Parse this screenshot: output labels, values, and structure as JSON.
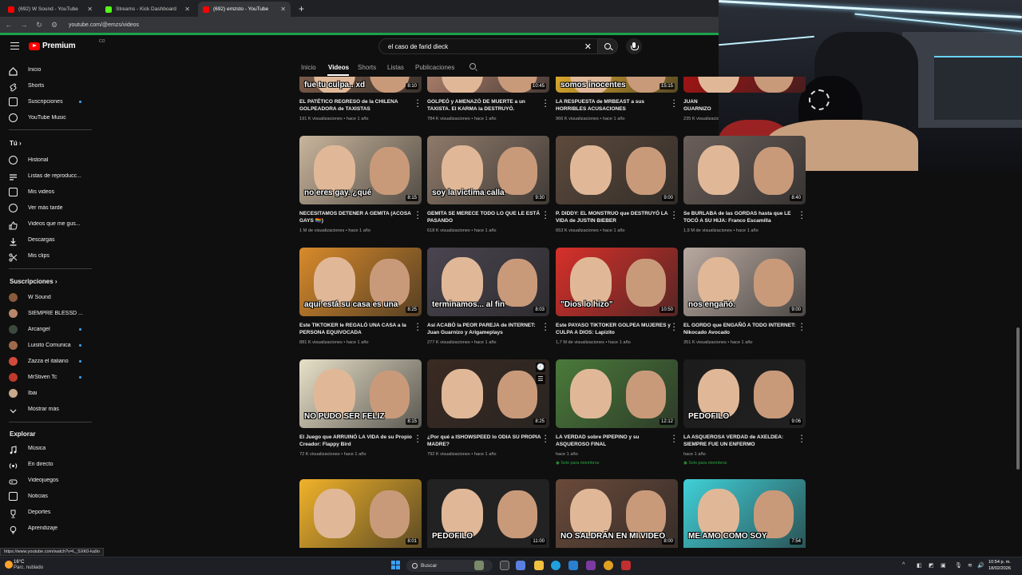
{
  "browser": {
    "tabs": [
      {
        "title": "(692) W Sound - YouTube",
        "color": "#ff0000",
        "active": false
      },
      {
        "title": "Streams - Kick Dashboard",
        "color": "#53fc18",
        "active": false
      },
      {
        "title": "(692) emzsto - YouTube",
        "color": "#ff0000",
        "active": true
      }
    ],
    "new_tab": "+",
    "url": "youtube.com/@emzs/videos",
    "status_url": "https://www.youtube.com/watch?v=L_SXK0-ka9o"
  },
  "yt": {
    "logo": "Premium",
    "logo_sup": "CO",
    "search_value": "el caso de farid dieck",
    "clear": "✕"
  },
  "channel_tabs": [
    "Inicio",
    "Videos",
    "Shorts",
    "Listas",
    "Publicaciones"
  ],
  "sidebar": {
    "main": [
      "Inicio",
      "Shorts",
      "Suscripciones",
      "YouTube Music"
    ],
    "you_header": "Tú",
    "you_items": [
      "Historial",
      "Listas de reproducc...",
      "Mis videos",
      "Ver más tarde",
      "Videos que me gus...",
      "Descargas",
      "Mis clips"
    ],
    "subs_header": "Suscripciones",
    "subs": [
      {
        "name": "W Sound",
        "color": "#8a5a3c",
        "dot": false
      },
      {
        "name": "SIEMPRE BLESSD ...",
        "color": "#b8866a",
        "dot": false
      },
      {
        "name": "Arcangel",
        "color": "#3b4a3c",
        "dot": true
      },
      {
        "name": "Luisito Comunica",
        "color": "#a06a4a",
        "dot": true
      },
      {
        "name": "Zazza el italiano",
        "color": "#d44a3a",
        "dot": true
      },
      {
        "name": "MrStiven Tc",
        "color": "#c0392b",
        "dot": true
      },
      {
        "name": "Ibai",
        "color": "#c9a98a",
        "dot": false
      }
    ],
    "more": "Mostrar más",
    "explore_header": "Explorar",
    "explore": [
      "Música",
      "En directo",
      "Videojuegos",
      "Noticias",
      "Deportes",
      "Aprendizaje"
    ]
  },
  "videos": [
    {
      "caption": "fue tu culpa.. xd",
      "dur": "8:10",
      "title": "EL PATÉTICO REGRESO de la CHILENA GOLPEADORA de TAXISTAS",
      "meta": "191 K visualizaciones • hace 1 año",
      "bg": "#7a5a48",
      "members": ""
    },
    {
      "caption": "",
      "dur": "10:45",
      "title": "GOLPEÓ y AMENAZÓ DE MUERTE a un TAXISTA. El KARMA la DESTRUYÓ.",
      "meta": "784 K visualizaciones • hace 1 año",
      "bg": "#a77b68",
      "members": ""
    },
    {
      "caption": "somos inocentes",
      "dur": "15:15",
      "title": "LA RESPUESTA de MRBEAST a sus HORRIBLES ACUSACIONES",
      "meta": "966 K visualizaciones • hace 1 año",
      "bg": "#d9a72c",
      "members": ""
    },
    {
      "caption": "",
      "dur": "",
      "title": "JUAN GUARNIZO ES UN PELUCÓN Y es un CUCK",
      "meta": "235 K visualizaciones • hace 1 año",
      "bg": "#a01414",
      "members": ""
    },
    {
      "caption": "no eres gay. ¿qué",
      "dur": "8:15",
      "title": "NECESITAMOS DETENER A GEMITA (ACOSA GAYS 🏳️‍🌈)",
      "meta": "1 M de visualizaciones • hace 1 año",
      "bg": "#c9b59c",
      "members": ""
    },
    {
      "caption": "soy la victima calla",
      "dur": "9:30",
      "title": "GEMITA SE MERECE TODO LO QUE LE ESTÁ PASANDO",
      "meta": "618 K visualizaciones • hace 1 año",
      "bg": "#8f7a6a",
      "members": ""
    },
    {
      "caption": "",
      "dur": "9:00",
      "title": "P. DIDDY: EL MONSTRUO que DESTRUYÓ LA VIDA de JUSTIN BIEBER",
      "meta": "653 K visualizaciones • hace 1 año",
      "bg": "#5d4a3c",
      "members": ""
    },
    {
      "caption": "",
      "dur": "8:40",
      "title": "Se BURLABA de las GORDAS hasta que LE TOCÓ A SU HIJA: Franco Escamilla",
      "meta": "1,9 M de visualizaciones • hace 1 año",
      "bg": "#6b5f5a",
      "members": ""
    },
    {
      "caption": "aquí está su casa  es una",
      "dur": "8:25",
      "title": "Este TIKTOKER le REGALÓ UNA CASA a la PERSONA EQUIVOCADA",
      "meta": "881 K visualizaciones • hace 1 año",
      "bg": "#d88a2a",
      "members": ""
    },
    {
      "caption": "terminamos... al fin",
      "dur": "8:03",
      "title": "Así ACABÓ la PEOR PAREJA de INTERNET: Juan Guarnizo y Arigameplays",
      "meta": "277 K visualizaciones • hace 1 año",
      "bg": "#4a4550",
      "members": ""
    },
    {
      "caption": "\"Dios lo hizo\"",
      "dur": "10:50",
      "title": "Este PAYASO TIKTOKER GOLPEA MUJERES y CULPA A DIOS: Lapizito",
      "meta": "1,7 M de visualizaciones • hace 1 año",
      "bg": "#d8302a",
      "members": ""
    },
    {
      "caption": "nos engañó.",
      "dur": "9:00",
      "title": "EL GORDO que ENGAÑÓ A TODO INTERNET: Nikocado Avocado",
      "meta": "351 K visualizaciones • hace 1 año",
      "bg": "#b9a9a0",
      "members": ""
    },
    {
      "caption": "NO PUDO SER FELIZ",
      "dur": "8:15",
      "title": "El Juego que ARRUINÓ LA VIDA de su Propio Creador: Flappy Bird",
      "meta": "72 K visualizaciones • hace 1 año",
      "bg": "#e8e0c8",
      "members": ""
    },
    {
      "caption": "",
      "dur": "8:25",
      "title": "¿Por qué a ISHOWSPEED lo ODIA SU PROPIA MADRE?",
      "meta": "792 K visualizaciones • hace 1 año",
      "bg": "#3a2a22",
      "members": ""
    },
    {
      "caption": "",
      "dur": "12:12",
      "title": "LA VERDAD sobre PIPEPINO y su ASQUEROSO FINAL",
      "meta": "hace 1 año",
      "bg": "#4a7a3a",
      "members": "Solo para miembros"
    },
    {
      "caption": "PEDOFILO",
      "dur": "9:06",
      "title": "LA ASQUEROSA VERDAD de AXELDEA: SIEMPRE FUE UN ENFERMO",
      "meta": "hace 1 año",
      "bg": "#1c1c1c",
      "members": "Solo para miembros"
    },
    {
      "caption": "",
      "dur": "8:01",
      "title": "",
      "meta": "",
      "bg": "#f0b22a",
      "members": ""
    },
    {
      "caption": "PEDOFILO",
      "dur": "11:00",
      "title": "",
      "meta": "",
      "bg": "#222222",
      "members": ""
    },
    {
      "caption": "NO SALDRÁN EN MI VIDEO",
      "dur": "8:00",
      "title": "",
      "meta": "",
      "bg": "#6a4a3a",
      "members": ""
    },
    {
      "caption": "ME AMO COMO SOY",
      "dur": "7:54",
      "title": "",
      "meta": "",
      "bg": "#40d0d8",
      "members": ""
    }
  ],
  "taskbar": {
    "temp": "16°C",
    "condition": "Parc. nublado",
    "search": "Buscar",
    "time": "10:54 p. m.",
    "date": "18/02/2026"
  }
}
